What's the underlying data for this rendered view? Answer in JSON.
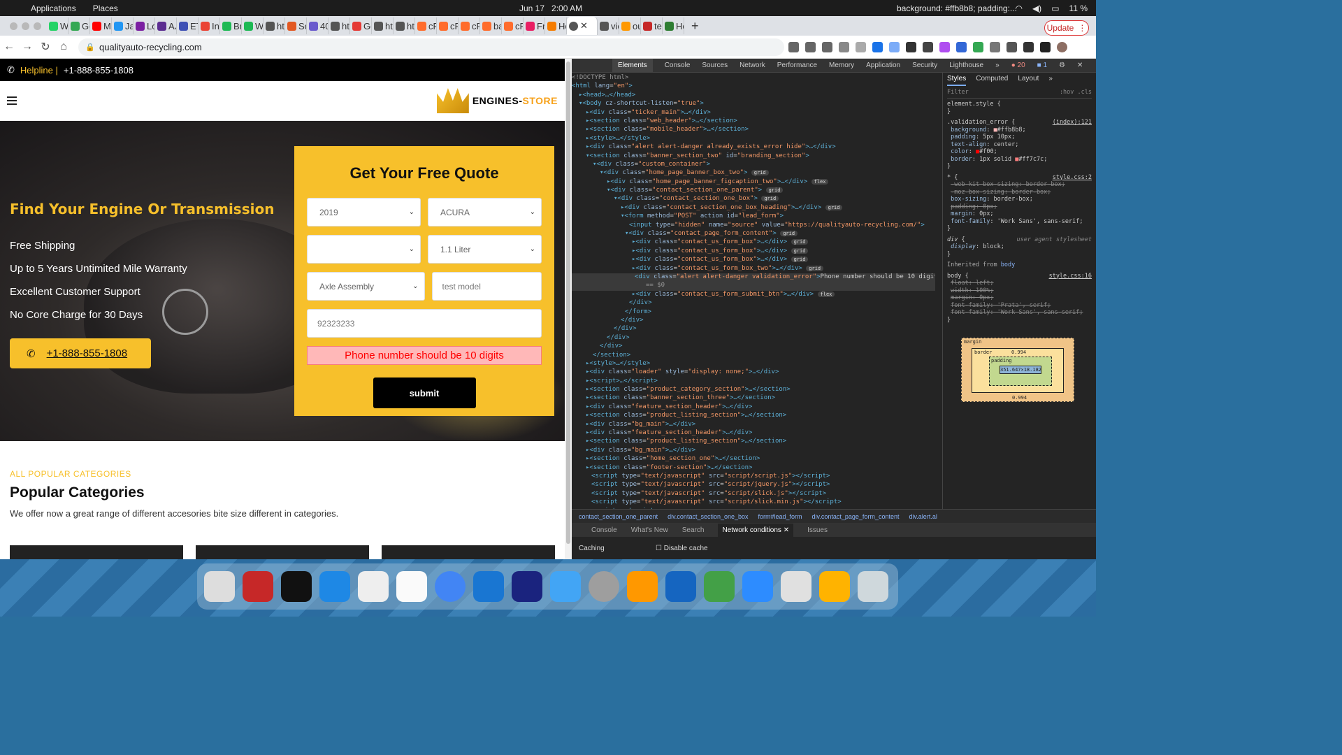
{
  "os": {
    "menu_apps": "Applications",
    "menu_places": "Places",
    "date": "Jun 17",
    "time": "2:00 AM",
    "status": "background: #ffb8b8; padding:...",
    "battery": "11 %"
  },
  "tabs": [
    {
      "label": "Wl",
      "color": "#25d366"
    },
    {
      "label": "Go",
      "color": "#34a853"
    },
    {
      "label": "Mu",
      "color": "#ff0000"
    },
    {
      "label": "Jav",
      "color": "#2196f3"
    },
    {
      "label": "Lo",
      "color": "#7b1fa2"
    },
    {
      "label": "AJ",
      "color": "#5c2d91"
    },
    {
      "label": "ET",
      "color": "#3f51b5"
    },
    {
      "label": "Inl",
      "color": "#ea4335"
    },
    {
      "label": "Bro",
      "color": "#1db954"
    },
    {
      "label": "We",
      "color": "#1db954"
    },
    {
      "label": "htt",
      "color": "#555"
    },
    {
      "label": "So",
      "color": "#e25822"
    },
    {
      "label": "40",
      "color": "#6a5acd"
    },
    {
      "label": "htt",
      "color": "#555"
    },
    {
      "label": "Ge",
      "color": "#e53935"
    },
    {
      "label": "htt",
      "color": "#555"
    },
    {
      "label": "htt",
      "color": "#555"
    },
    {
      "label": "cP",
      "color": "#ff6c2c"
    },
    {
      "label": "cP",
      "color": "#ff6c2c"
    },
    {
      "label": "cP",
      "color": "#ff6c2c"
    },
    {
      "label": "ba",
      "color": "#ff6c2c"
    },
    {
      "label": "cP",
      "color": "#ff6c2c"
    },
    {
      "label": "Fri",
      "color": "#e91e63"
    },
    {
      "label": "Ho",
      "color": "#f57c00"
    }
  ],
  "active_tab": {
    "label": "",
    "color": "#555"
  },
  "tabs_after": [
    {
      "label": "vie",
      "color": "#555"
    },
    {
      "label": "out",
      "color": "#ff9800"
    },
    {
      "label": "tes",
      "color": "#c62828"
    },
    {
      "label": "Ho",
      "color": "#2e7d32"
    }
  ],
  "browser": {
    "url": "qualityauto-recycling.com",
    "update_label": "Update"
  },
  "site": {
    "helpline_label": "Helpline |",
    "helpline_number": "+1-888-855-1808",
    "logo_a": "ENGINES-",
    "logo_b": "STORE",
    "headline": "Find Your Engine Or Transmission",
    "features": [
      "Free Shipping",
      "Up to 5 Years Untimited Mile Warranty",
      "Excellent Customer Support",
      "No Core Charge for 30 Days"
    ],
    "call_number": "+1-888-855-1808",
    "quote": {
      "title": "Get Your Free Quote",
      "year": "2019",
      "make": "ACURA",
      "model": "",
      "size": "1.1 Liter",
      "part": "Axle Assembly",
      "model_input": "test model",
      "phone": "92323233",
      "error": "Phone number should be 10 digits",
      "submit": "submit"
    },
    "cats": {
      "kicker": "ALL POPULAR CATEGORIES",
      "title": "Popular Categories",
      "desc": "We offer now a great range of different accesories bite size different in categories."
    }
  },
  "devtools": {
    "tabs": [
      "Elements",
      "Console",
      "Sources",
      "Network",
      "Performance",
      "Memory",
      "Application",
      "Security",
      "Lighthouse"
    ],
    "errors": "20",
    "warnings": "1",
    "style_tabs": [
      "Styles",
      "Computed",
      "Layout"
    ],
    "filter": "Filter",
    "hov": ":hov .cls",
    "crumbs": [
      "contact_section_one_parent",
      "div.contact_section_one_box",
      "form#lead_form",
      "div.contact_page_form_content",
      "div.alert.al"
    ],
    "drawer_tabs": [
      "Console",
      "What's New",
      "Search",
      "Network conditions",
      "Issues"
    ],
    "caching": "Caching",
    "disable_cache": "Disable cache",
    "box": {
      "margin": "margin",
      "margin_v": "0.994",
      "border": "border",
      "border_v": "0.994",
      "padding": "padding",
      "padding_v": "5",
      "padding_h": "10",
      "content": "351.647×18.182"
    }
  }
}
